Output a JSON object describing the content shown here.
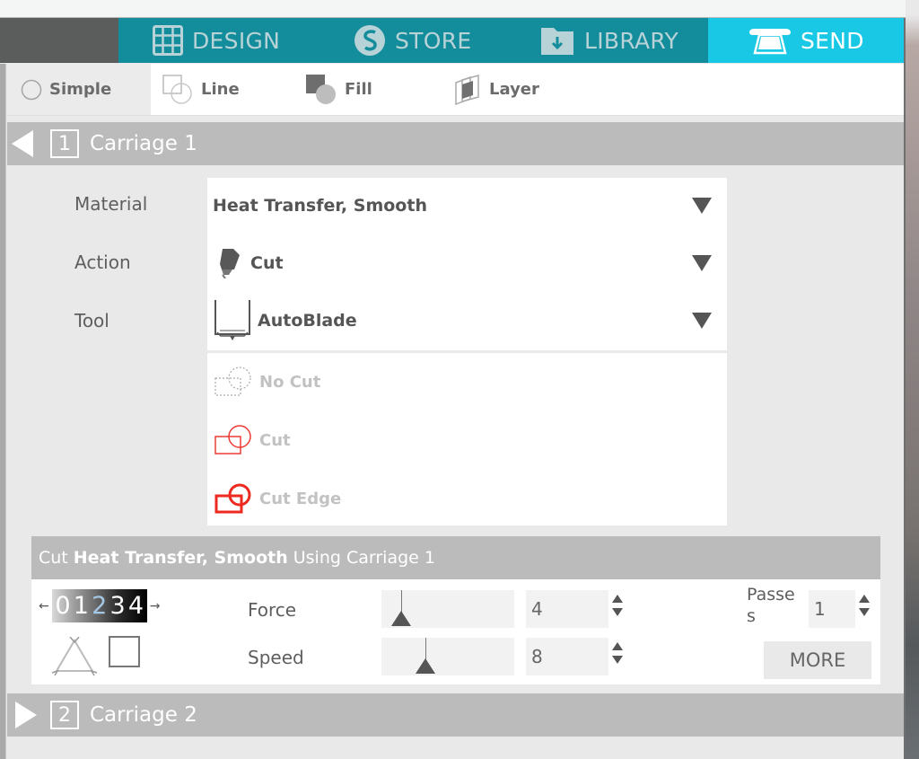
{
  "nav": {
    "tabs": [
      {
        "label": "DESIGN",
        "icon": "grid-icon",
        "active": false
      },
      {
        "label": "STORE",
        "icon": "silhouette-s-icon",
        "active": false
      },
      {
        "label": "LIBRARY",
        "icon": "folder-download-icon",
        "active": false
      },
      {
        "label": "SEND",
        "icon": "cutter-machine-icon",
        "active": true
      }
    ],
    "colors": {
      "bar": "#138c9b",
      "active": "#19c8e4",
      "inactive_text": "#b8d3d7"
    }
  },
  "modes": [
    {
      "label": "Simple",
      "icon": "radio-circle-icon",
      "active": true
    },
    {
      "label": "Line",
      "icon": "line-shapes-icon",
      "active": false
    },
    {
      "label": "Fill",
      "icon": "fill-shapes-icon",
      "active": false
    },
    {
      "label": "Layer",
      "icon": "layer-icon",
      "active": false
    }
  ],
  "carriage1": {
    "number": "1",
    "label": "Carriage 1",
    "expanded": true,
    "fields": {
      "material_label": "Material",
      "material_value": "Heat Transfer, Smooth",
      "action_label": "Action",
      "action_value": "Cut",
      "tool_label": "Tool",
      "tool_value": "AutoBlade"
    },
    "options": [
      {
        "label": "No Cut",
        "icon": "no-cut-icon"
      },
      {
        "label": "Cut",
        "icon": "cut-shapes-icon"
      },
      {
        "label": "Cut Edge",
        "icon": "cut-edge-icon"
      }
    ]
  },
  "summary": {
    "prefix": "Cut",
    "material": "Heat Transfer, Smooth",
    "suffix": "Using Carriage 1",
    "blade_dial_digits": [
      "0",
      "1",
      "2",
      "3",
      "4"
    ],
    "force_label": "Force",
    "force_value": "4",
    "force_slider_fraction": 0.03,
    "speed_label": "Speed",
    "speed_value": "8",
    "speed_slider_fraction": 0.27,
    "passes_label_line1": "Passe",
    "passes_label_line2": "s",
    "passes_value": "1",
    "more_label": "MORE"
  },
  "carriage2": {
    "number": "2",
    "label": "Carriage 2",
    "expanded": false
  }
}
